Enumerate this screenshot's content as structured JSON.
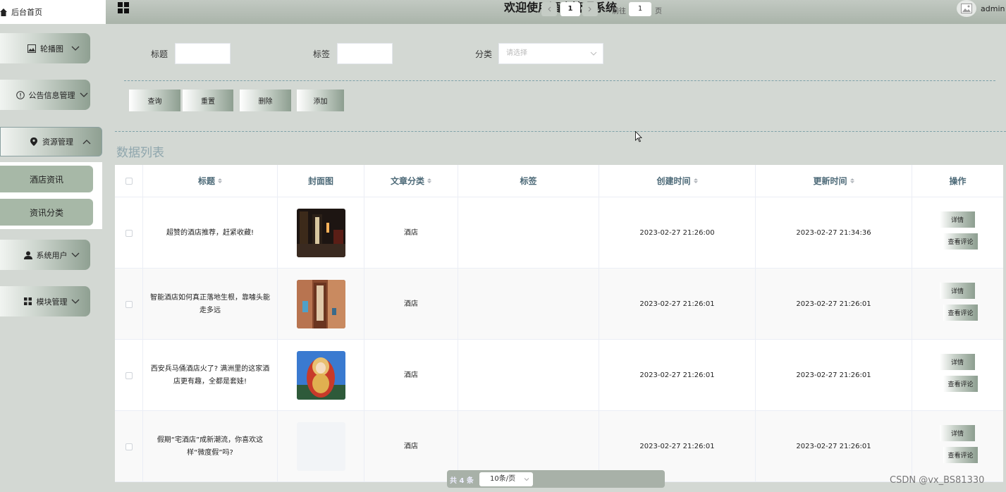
{
  "sidebar": {
    "home_label": "后台首页",
    "menus": [
      {
        "label": "轮播图",
        "icon": "image-icon"
      },
      {
        "label": "公告信息管理",
        "icon": "info-icon"
      },
      {
        "label": "资源管理",
        "icon": "location-pin-icon"
      },
      {
        "label": "系统用户",
        "icon": "user-icon"
      },
      {
        "label": "模块管理",
        "icon": "grid-icon"
      }
    ],
    "submenu": [
      {
        "label": "酒店资讯"
      },
      {
        "label": "资讯分类"
      }
    ]
  },
  "header": {
    "title": "欢迎使用酒店管理系统",
    "user": "admin"
  },
  "search": {
    "title_label": "标题",
    "tag_label": "标签",
    "category_label": "分类",
    "category_placeholder": "请选择",
    "buttons": {
      "query": "查询",
      "reset": "重置",
      "delete": "删除",
      "add": "添加"
    }
  },
  "list_title": "数据列表",
  "table": {
    "columns": {
      "title": "标题",
      "cover": "封面图",
      "category": "文章分类",
      "tag": "标签",
      "created": "创建时间",
      "updated": "更新时间",
      "ops": "操作"
    },
    "rows": [
      {
        "title": "超赞的酒店推荐，赶紧收藏!",
        "category": "酒店",
        "tag": "",
        "created": "2023-02-27 21:26:00",
        "updated": "2023-02-27 21:34:36"
      },
      {
        "title": "智能酒店如何真正落地生根，靠噱头能走多远",
        "category": "酒店",
        "tag": "",
        "created": "2023-02-27 21:26:01",
        "updated": "2023-02-27 21:26:01"
      },
      {
        "title": "西安兵马俑酒店火了? 满洲里的这家酒店更有趣，全都是套娃!",
        "category": "酒店",
        "tag": "",
        "created": "2023-02-27 21:26:01",
        "updated": "2023-02-27 21:26:01"
      },
      {
        "title": "假期“宅酒店”成新潮流，你喜欢这样“微度假”吗?",
        "category": "酒店",
        "tag": "",
        "created": "2023-02-27 21:26:01",
        "updated": "2023-02-27 21:26:01"
      }
    ],
    "detail_label": "详情",
    "comment_label": "查看评论"
  },
  "pagination": {
    "total": "共 4 条",
    "page_size": "10条/页",
    "current": "1",
    "goto_prefix": "前往",
    "goto_value": "1",
    "goto_suffix": "页"
  },
  "watermark": "CSDN @vx_BS81330"
}
